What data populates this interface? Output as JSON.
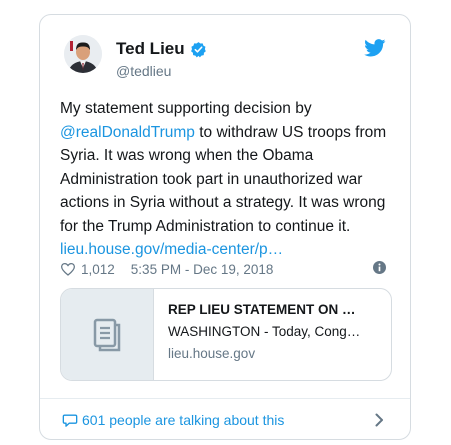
{
  "tweet": {
    "author_name": "Ted Lieu",
    "handle": "@tedlieu",
    "text_before": "My statement supporting decision by",
    "mention": "@realDonaldTrump",
    "text_after": "to withdraw US troops from Syria. It was wrong when the Obama Administration took part in unauthorized war actions in Syria without a strategy. It was wrong for the Trump Administration to continue it.",
    "url_text": "lieu.house.gov/media-center/p…",
    "likes": "1,012",
    "timestamp": "5:35 PM - Dec 19, 2018"
  },
  "link_card": {
    "title": "REP LIEU STATEMENT ON …",
    "description": "WASHINGTON - Today, Cong…",
    "domain": "lieu.house.gov"
  },
  "footer": {
    "talking": "601 people are talking about this"
  },
  "icons": {
    "verified": "verified-badge-icon",
    "logo": "twitter-bird-icon",
    "like": "heart-icon",
    "info": "info-icon",
    "link_thumb": "document-icon",
    "reply": "speech-bubble-icon",
    "chevron": "chevron-right-icon"
  },
  "colors": {
    "accent": "#1da1f2",
    "link": "#1b95e0",
    "secondary_text": "#657786",
    "border": "#d6dce1"
  }
}
